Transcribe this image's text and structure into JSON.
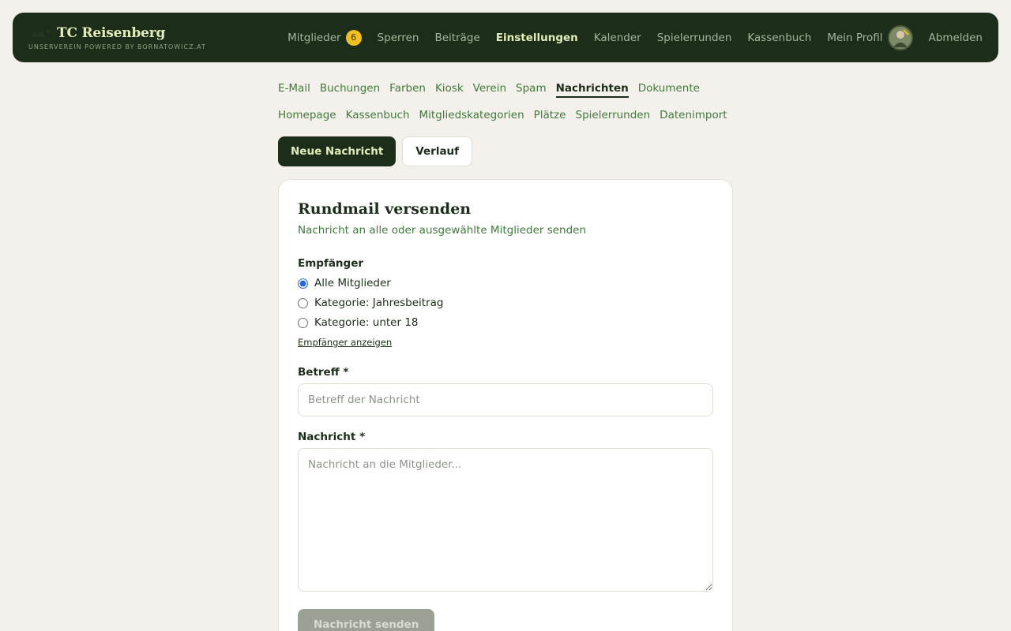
{
  "brand": {
    "title": "TC Reisenberg",
    "subtitle": "UNSERVEREIN POWERED BY BORNATOWICZ.AT"
  },
  "nav": {
    "items": [
      {
        "label": "Mitglieder",
        "badge": "6"
      },
      {
        "label": "Sperren"
      },
      {
        "label": "Beiträge"
      },
      {
        "label": "Einstellungen",
        "active": true
      },
      {
        "label": "Kalender"
      },
      {
        "label": "Spielerrunden"
      },
      {
        "label": "Kassenbuch"
      },
      {
        "label": "Mein Profil"
      },
      {
        "label": "Abmelden"
      }
    ]
  },
  "settings_tabs": {
    "row1": [
      "E-Mail",
      "Buchungen",
      "Farben",
      "Kiosk",
      "Verein",
      "Spam",
      "Nachrichten",
      "Dokumente"
    ],
    "row2": [
      "Homepage",
      "Kassenbuch",
      "Mitgliedskategorien",
      "Plätze",
      "Spielerrunden",
      "Datenimport"
    ],
    "active": "Nachrichten"
  },
  "mode": {
    "new_label": "Neue Nachricht",
    "history_label": "Verlauf"
  },
  "card": {
    "title": "Rundmail versenden",
    "subtitle": "Nachricht an alle oder ausgewählte Mitglieder senden",
    "recipients_label": "Empfänger",
    "recipient_options": [
      "Alle Mitglieder",
      "Kategorie: Jahresbeitrag",
      "Kategorie: unter 18"
    ],
    "recipient_selected": 0,
    "show_recipients_label": "Empfänger anzeigen",
    "subject_label": "Betreff *",
    "subject_placeholder": "Betreff der Nachricht",
    "subject_value": "",
    "message_label": "Nachricht *",
    "message_placeholder": "Nachricht an die Mitglieder...",
    "message_value": "",
    "send_label": "Nachricht senden"
  },
  "colors": {
    "header_bg": "#1c2e1a",
    "accent": "#e4edb9",
    "link_green": "#3f7a3a",
    "badge": "#f2c01c",
    "page_bg": "#f4f1ec"
  }
}
